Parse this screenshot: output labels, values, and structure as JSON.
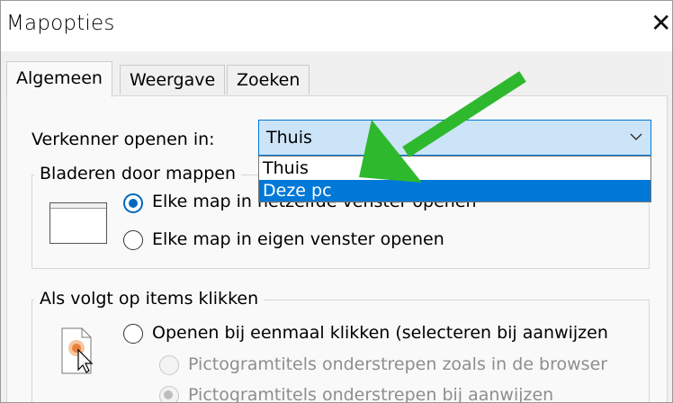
{
  "window": {
    "title": "Mapopties",
    "close_glyph": "✕"
  },
  "tabs": [
    {
      "label": "Algemeen",
      "active": true
    },
    {
      "label": "Weergave",
      "active": false
    },
    {
      "label": "Zoeken",
      "active": false
    }
  ],
  "open_in": {
    "label": "Verkenner openen in:",
    "selected": "Thuis",
    "options": [
      {
        "label": "Thuis",
        "highlighted": false
      },
      {
        "label": "Deze pc",
        "highlighted": true
      }
    ]
  },
  "browse_group": {
    "title": "Bladeren door mappen",
    "options": [
      {
        "label": "Elke map in hetzelfde venster openen",
        "checked": true
      },
      {
        "label": "Elke map in eigen venster openen",
        "checked": false
      }
    ]
  },
  "click_group": {
    "title": "Als volgt op items klikken",
    "options": [
      {
        "label": "Openen bij eenmaal klikken (selecteren bij aanwijzen",
        "checked": false
      },
      {
        "label": "Pictogramtitels onderstrepen zoals in de browser",
        "checked": false,
        "disabled": true
      },
      {
        "label": "Pictogramtitels onderstrepen bij aanwijzen",
        "checked": true,
        "disabled": true
      }
    ]
  },
  "annotation": {
    "arrow_color": "#2eb82e"
  },
  "colors": {
    "accent": "#0078d7",
    "combo_bg": "#cce4f7"
  }
}
